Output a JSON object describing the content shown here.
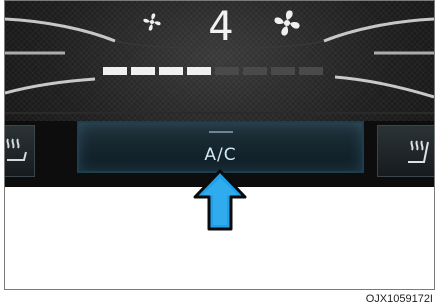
{
  "climate_panel": {
    "fan_speed": "4",
    "fan_level_fraction": 0.5,
    "ac_button": {
      "label": "A/C"
    },
    "icons": {
      "fan_low": "fan-low-icon",
      "fan_high": "fan-high-icon",
      "seat_heater_left": "seat-heater-left-icon",
      "seat_heater_right": "seat-heater-right-icon",
      "press_arrow": "blue-up-arrow-icon"
    },
    "colors": {
      "level_active": "#f0f0f0",
      "level_inactive": "#4a4a4a",
      "arrow_fill": "#1fa0e8",
      "ac_glow": "#2a6b86"
    }
  },
  "figure_code": "OJX1059172I"
}
